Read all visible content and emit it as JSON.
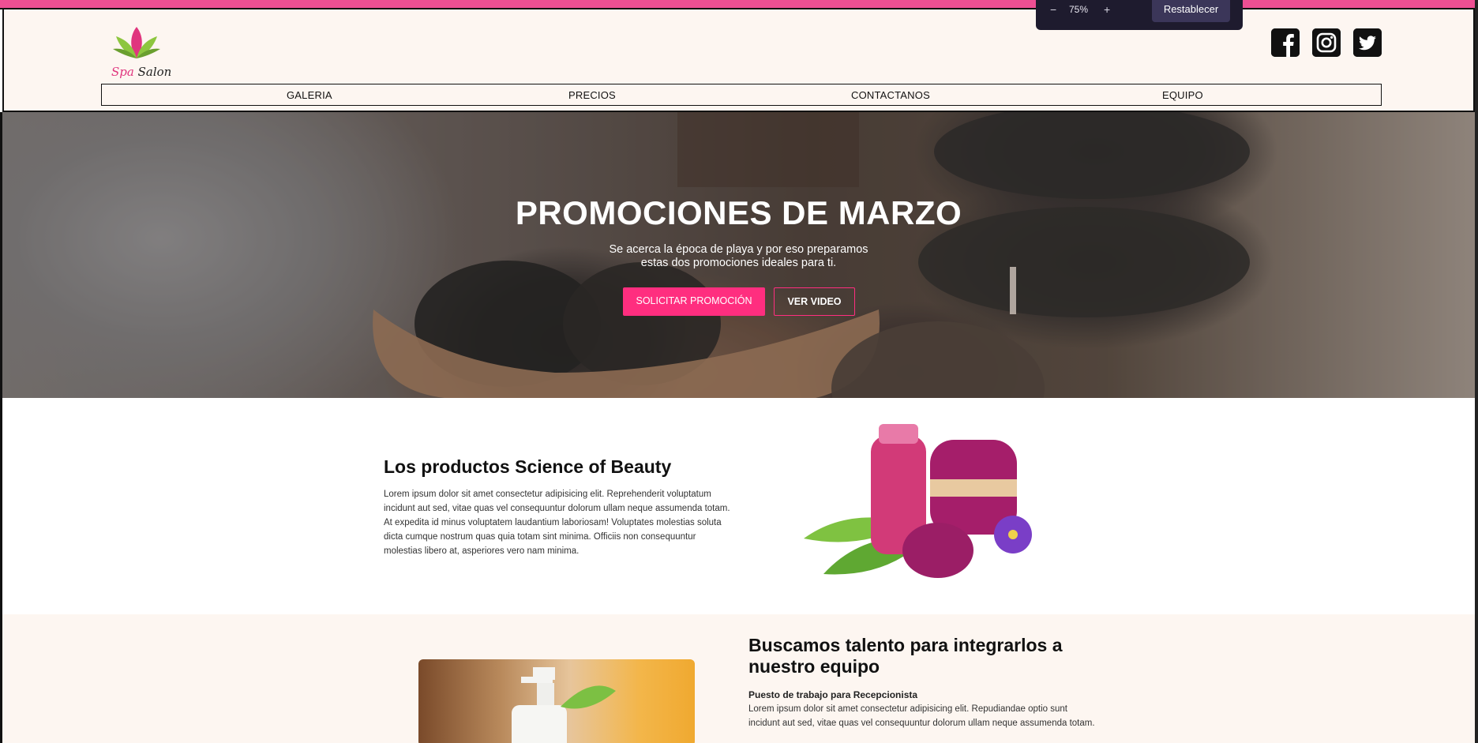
{
  "header": {
    "logo": {
      "word1": "Spa",
      "word2": "Salon"
    },
    "nav": [
      {
        "label": "GALERIA"
      },
      {
        "label": "PRECIOS"
      },
      {
        "label": "CONTACTANOS"
      },
      {
        "label": "EQUIPO"
      }
    ],
    "social": [
      "facebook-icon",
      "instagram-icon",
      "twitter-icon"
    ]
  },
  "zoom_toolbar": {
    "minus": "−",
    "level": "75%",
    "plus": "+",
    "reset_label": "Restablecer"
  },
  "hero": {
    "title": "PROMOCIONES DE MARZO",
    "line1": "Se acerca la época de playa y por eso preparamos",
    "line2": "estas dos promociones ideales para ti.",
    "primary_button": "SOLICITAR PROMOCIÓN",
    "secondary_button": "VER VIDEO"
  },
  "products_section": {
    "title": "Los productos Science of Beauty",
    "body": "Lorem ipsum dolor sit amet consectetur adipisicing elit. Reprehenderit voluptatum incidunt aut sed, vitae quas vel consequuntur dolorum ullam neque assumenda totam. At expedita id minus voluptatem laudantium laboriosam! Voluptates molestias soluta dicta cumque nostrum quas quia totam sint minima. Officiis non consequuntur molestias libero at, asperiores vero nam minima."
  },
  "talent_section": {
    "title": "Buscamos talento para integrarlos a nuestro equipo",
    "subtitle": "Puesto de trabajo para Recepcionista",
    "body": "Lorem ipsum dolor sit amet consectetur adipisicing elit. Repudiandae optio sunt incidunt aut sed, vitae quas vel consequuntur dolorum ullam neque assumenda totam."
  },
  "colors": {
    "accent": "#ff2e7f",
    "header_bg": "#fdf6f1",
    "toolbar_bg": "#1e1b2e"
  }
}
